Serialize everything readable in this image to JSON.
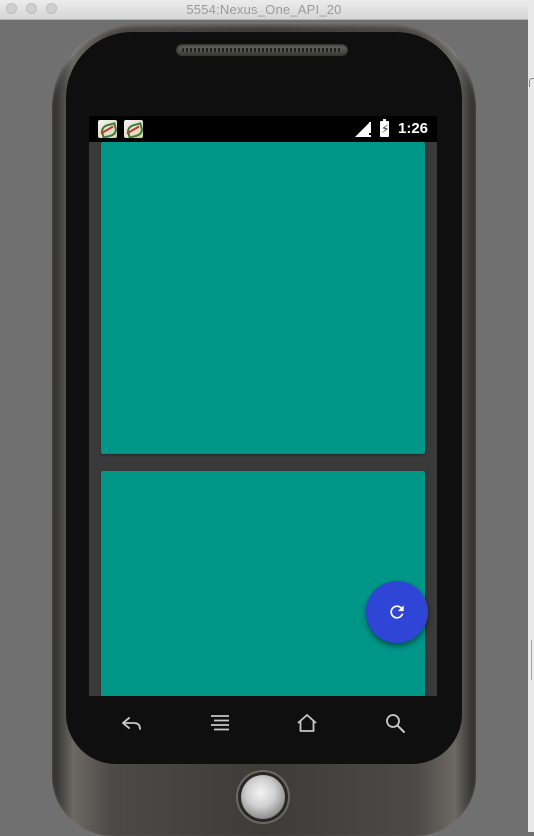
{
  "window": {
    "title": "5554:Nexus_One_API_20"
  },
  "status_bar": {
    "notification_icons": [
      "app-notification-icon",
      "app-notification-icon"
    ],
    "signal": "signal-no-data-icon",
    "battery": "battery-charging-icon",
    "time": "1:26"
  },
  "content": {
    "card_color": "#009688",
    "background_color": "#3a3a3a"
  },
  "fab": {
    "icon": "refresh-icon",
    "color": "#2f45d6"
  },
  "hardware_keys": [
    "back-icon",
    "menu-icon",
    "home-icon",
    "search-icon"
  ]
}
